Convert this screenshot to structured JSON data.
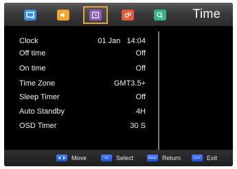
{
  "header": {
    "title": "Time",
    "tabs": [
      {
        "icon": "picture-icon",
        "color": "#3b8fe0"
      },
      {
        "icon": "sound-icon",
        "color": "#f2a830"
      },
      {
        "icon": "time-icon",
        "color": "#8f5bb8",
        "selected": true
      },
      {
        "icon": "setup-icon",
        "color": "#e85a3c"
      },
      {
        "icon": "search-icon",
        "color": "#37b38a"
      }
    ]
  },
  "settings": [
    {
      "label": "Clock",
      "value": "01 Jan   14:04"
    },
    {
      "label": "Off time",
      "value": "Off"
    },
    {
      "label": "On time",
      "value": "Off"
    },
    {
      "label": "Time Zone",
      "value": "GMT3.5+"
    },
    {
      "label": "Sleep Timer",
      "value": "Off"
    },
    {
      "label": "Auto Standby",
      "value": "4H"
    },
    {
      "label": "OSD Timer",
      "value": "30 S"
    }
  ],
  "footer": {
    "move": "Move",
    "select": "Select",
    "return": "Return",
    "exit": "Exit",
    "select_key": "OK",
    "return_key": "MENU",
    "exit_key": "EXIT",
    "key_color": "#2a5fe8"
  }
}
